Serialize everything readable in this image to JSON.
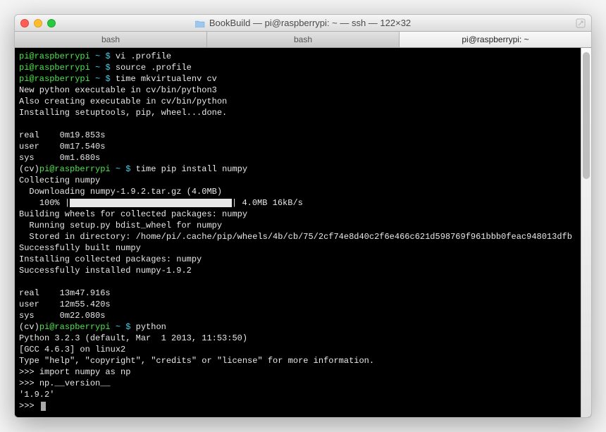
{
  "window": {
    "title": "BookBuild — pi@raspberrypi: ~ — ssh — 122×32"
  },
  "tabs": [
    {
      "label": "bash",
      "active": false
    },
    {
      "label": "bash",
      "active": false
    },
    {
      "label": "pi@raspberrypi: ~",
      "active": true
    }
  ],
  "prompt": {
    "user_host": "pi@raspberrypi",
    "path": "~",
    "sigil": "$"
  },
  "venv_prefix": "(cv)",
  "commands": {
    "c1": "vi .profile",
    "c2": "source .profile",
    "c3": "time mkvirtualenv cv",
    "c4": "time pip install numpy",
    "c5": "python"
  },
  "output": {
    "mkvirtualenv": [
      "New python executable in cv/bin/python3",
      "Also creating executable in cv/bin/python",
      "Installing setuptools, pip, wheel...done."
    ],
    "timing1": {
      "real": "0m19.853s",
      "user": "0m17.540s",
      "sys": "0m1.680s"
    },
    "pip": {
      "collecting": "Collecting numpy",
      "downloading": "  Downloading numpy-1.9.2.tar.gz (4.0MB)",
      "progress_pct": "100%",
      "progress_stats": "4.0MB 16kB/s",
      "building": "Building wheels for collected packages: numpy",
      "running_bdist": "  Running setup.py bdist_wheel for numpy",
      "stored": "  Stored in directory: /home/pi/.cache/pip/wheels/4b/cb/75/2cf74e8d40c2f6e466c621d598769f961bbb0feac948013dfb",
      "success_built": "Successfully built numpy",
      "installing": "Installing collected packages: numpy",
      "success_install": "Successfully installed numpy-1.9.2"
    },
    "timing2": {
      "real": "13m47.916s",
      "user": "12m55.420s",
      "sys": "0m22.080s"
    },
    "python": {
      "banner1": "Python 3.2.3 (default, Mar  1 2013, 11:53:50)",
      "banner2": "[GCC 4.6.3] on linux2",
      "banner3": "Type \"help\", \"copyright\", \"credits\" or \"license\" for more information.",
      "ps1": ">>>",
      "line1": "import numpy as np",
      "line2": "np.__version__",
      "result": "'1.9.2'"
    }
  },
  "labels": {
    "real": "real",
    "user": "user",
    "sys": "sys"
  }
}
